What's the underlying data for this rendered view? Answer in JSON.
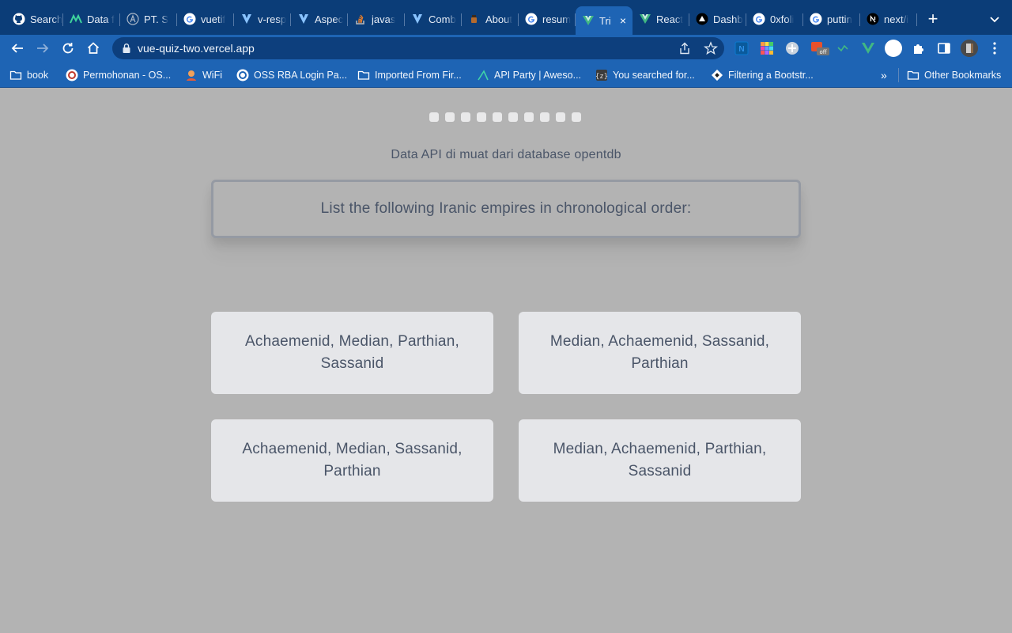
{
  "browser": {
    "tabs": [
      {
        "title": "Search",
        "icon": "github-icon"
      },
      {
        "title": "Data f",
        "icon": "m-logo-icon"
      },
      {
        "title": "PT. S",
        "icon": "a-logo-icon"
      },
      {
        "title": "vuetif",
        "icon": "google-icon"
      },
      {
        "title": "v-resp",
        "icon": "vuetify-icon"
      },
      {
        "title": "Aspec",
        "icon": "vuetify-icon"
      },
      {
        "title": "javas",
        "icon": "stackoverflow-icon"
      },
      {
        "title": "Comb",
        "icon": "vuetify-icon"
      },
      {
        "title": "About",
        "icon": "cup-icon"
      },
      {
        "title": "resum",
        "icon": "google-icon"
      },
      {
        "title": "Tri",
        "icon": "vue-icon",
        "active": true
      },
      {
        "title": "React",
        "icon": "vue-icon"
      },
      {
        "title": "Dashb",
        "icon": "triangle-icon"
      },
      {
        "title": "0xfoli",
        "icon": "google-icon"
      },
      {
        "title": "puttin",
        "icon": "google-icon"
      },
      {
        "title": "next/i",
        "icon": "nextjs-icon"
      }
    ],
    "new_tab_label": "+",
    "close_label": "×",
    "url": "vue-quiz-two.vercel.app",
    "bookmarks": [
      {
        "label": "book",
        "icon": "folder-icon"
      },
      {
        "label": "Permohonan - OS...",
        "icon": "oss-icon"
      },
      {
        "label": "WiFi",
        "icon": "wifi-avatar-icon"
      },
      {
        "label": "OSS RBA Login Pa...",
        "icon": "oss-icon"
      },
      {
        "label": "Imported From Fir...",
        "icon": "folder-icon"
      },
      {
        "label": "API Party | Aweso...",
        "icon": "api-party-icon"
      },
      {
        "label": "You searched for...",
        "icon": "z-icon"
      },
      {
        "label": "Filtering a Bootstr...",
        "icon": "diamond-icon"
      }
    ],
    "more_bookmarks_label": "»",
    "other_bookmarks_label": "Other Bookmarks",
    "extension_badge": "off"
  },
  "quiz": {
    "progress": {
      "total": 10,
      "answered": 0
    },
    "source_note": "Data API di muat dari database opentdb",
    "question": "List the following Iranic empires in chronological order:",
    "answers": [
      "Achaemenid, Median, Parthian, Sassanid",
      "Median, Achaemenid, Sassanid, Parthian",
      "Achaemenid, Median, Sassanid, Parthian",
      "Median, Achaemenid, Parthian, Sassanid"
    ]
  },
  "colors": {
    "tab_bar": "#0b3d78",
    "toolbar": "#1e64b4",
    "page_background": "#b3b3b3",
    "answer_card": "#e5e6e9",
    "text": "#4a5568"
  }
}
